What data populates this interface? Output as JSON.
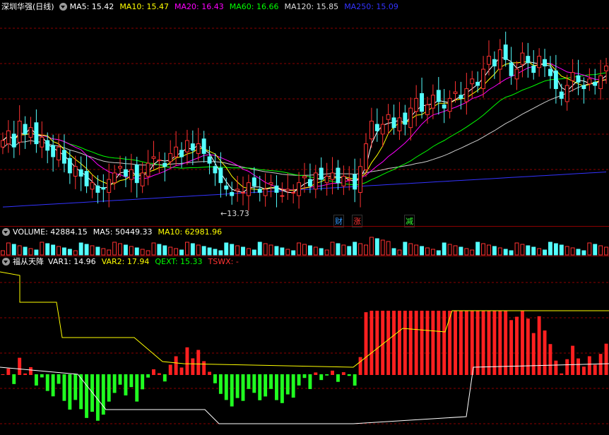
{
  "price_panel": {
    "title": "深圳华强(日线)",
    "indicators": [
      {
        "label": "MA5: 15.42",
        "color": "#ffffff"
      },
      {
        "label": "MA10: 15.47",
        "color": "#ffff00"
      },
      {
        "label": "MA20: 16.43",
        "color": "#ff00ff"
      },
      {
        "label": "MA60: 16.66",
        "color": "#00ff00"
      },
      {
        "label": "MA120: 15.85",
        "color": "#dddddd"
      },
      {
        "label": "MA250: 15.09",
        "color": "#3333ff"
      }
    ],
    "low_label": "13.73",
    "event_tags": [
      {
        "text": "财",
        "color": "#3399ff"
      },
      {
        "text": "涨",
        "color": "#ff3333"
      },
      {
        "text": "减",
        "color": "#33ff33"
      }
    ]
  },
  "volume_panel": {
    "indicators": [
      {
        "label": "VOLUME: 42884.15",
        "color": "#ffffff"
      },
      {
        "label": "MA5: 50449.33",
        "color": "#ffffff"
      },
      {
        "label": "MA10: 62981.96",
        "color": "#ffff00"
      }
    ]
  },
  "indicator_panel": {
    "title": "福从天降",
    "indicators": [
      {
        "label": "VAR1: 14.96",
        "color": "#ffffff"
      },
      {
        "label": "VAR2: 17.94",
        "color": "#ffff00"
      },
      {
        "label": "QEXT: 15.33",
        "color": "#00ff00"
      },
      {
        "label": "TSWX: -",
        "color": "#ff3333"
      }
    ]
  },
  "colors": {
    "up": "#ff3232",
    "down": "#54ffff",
    "grid": "#8b0000",
    "osc_pos": "#ff2020",
    "osc_neg": "#20ff20"
  },
  "chart_data": {
    "type": "candlestick",
    "close": [
      15.6,
      15.9,
      15.4,
      16.2,
      15.8,
      16.0,
      15.5,
      15.7,
      15.3,
      15.1,
      15.4,
      14.9,
      14.6,
      14.8,
      14.5,
      14.2,
      14.3,
      14.0,
      14.1,
      14.4,
      14.6,
      14.8,
      14.5,
      14.7,
      14.3,
      14.6,
      14.9,
      15.1,
      15.0,
      14.8,
      15.2,
      15.4,
      15.1,
      15.6,
      15.3,
      15.5,
      15.2,
      14.9,
      14.6,
      14.3,
      14.1,
      13.9,
      14.1,
      14.0,
      14.3,
      14.2,
      14.0,
      14.1,
      14.3,
      14.0,
      13.9,
      14.1,
      14.0,
      14.3,
      14.5,
      14.2,
      14.6,
      14.4,
      14.5,
      14.6,
      14.3,
      14.5,
      14.4,
      14.1,
      14.8,
      15.5,
      16.2,
      15.9,
      16.1,
      16.4,
      16.0,
      16.3,
      16.1,
      16.6,
      16.9,
      16.5,
      16.7,
      17.0,
      16.8,
      16.6,
      16.9,
      17.1,
      16.9,
      17.2,
      17.5,
      17.3,
      17.8,
      18.2,
      17.9,
      18.4,
      18.1,
      17.6,
      17.8,
      18.3,
      18.0,
      17.7,
      18.2,
      17.9,
      17.6,
      17.2,
      16.9,
      17.3,
      17.7,
      17.4,
      17.2,
      17.5,
      17.3,
      17.6,
      17.9
    ],
    "ma250": [
      13.55,
      13.56,
      13.57,
      13.58,
      13.59,
      13.6,
      13.61,
      13.62,
      13.63,
      13.64,
      13.65,
      13.66,
      13.67,
      13.68,
      13.69,
      13.7,
      13.71,
      13.72,
      13.73,
      13.74,
      13.75,
      13.76,
      13.77,
      13.78,
      13.79,
      13.8,
      13.81,
      13.82,
      13.83,
      13.84,
      13.85,
      13.86,
      13.87,
      13.88,
      13.89,
      13.9,
      13.91,
      13.92,
      13.93,
      13.94,
      13.95,
      13.96,
      13.97,
      13.98,
      13.99,
      14.0,
      14.01,
      14.02,
      14.03,
      14.04,
      14.05,
      14.06,
      14.07,
      14.08,
      14.09,
      14.1,
      14.11,
      14.12,
      14.13,
      14.14,
      14.15,
      14.16,
      14.17,
      14.18,
      14.19,
      14.2,
      14.21,
      14.22,
      14.23,
      14.24,
      14.25,
      14.26,
      14.27,
      14.28,
      14.29,
      14.3,
      14.31,
      14.32,
      14.33,
      14.34,
      14.35,
      14.36,
      14.37,
      14.38,
      14.39,
      14.4,
      14.41,
      14.42,
      14.43,
      14.44,
      14.45,
      14.46,
      14.47,
      14.48,
      14.49,
      14.5,
      14.51,
      14.52,
      14.53,
      14.54,
      14.55,
      14.56,
      14.57,
      14.58,
      14.59,
      14.6,
      14.61,
      14.62,
      14.63
    ],
    "ylim": [
      13.4,
      19.5
    ]
  }
}
